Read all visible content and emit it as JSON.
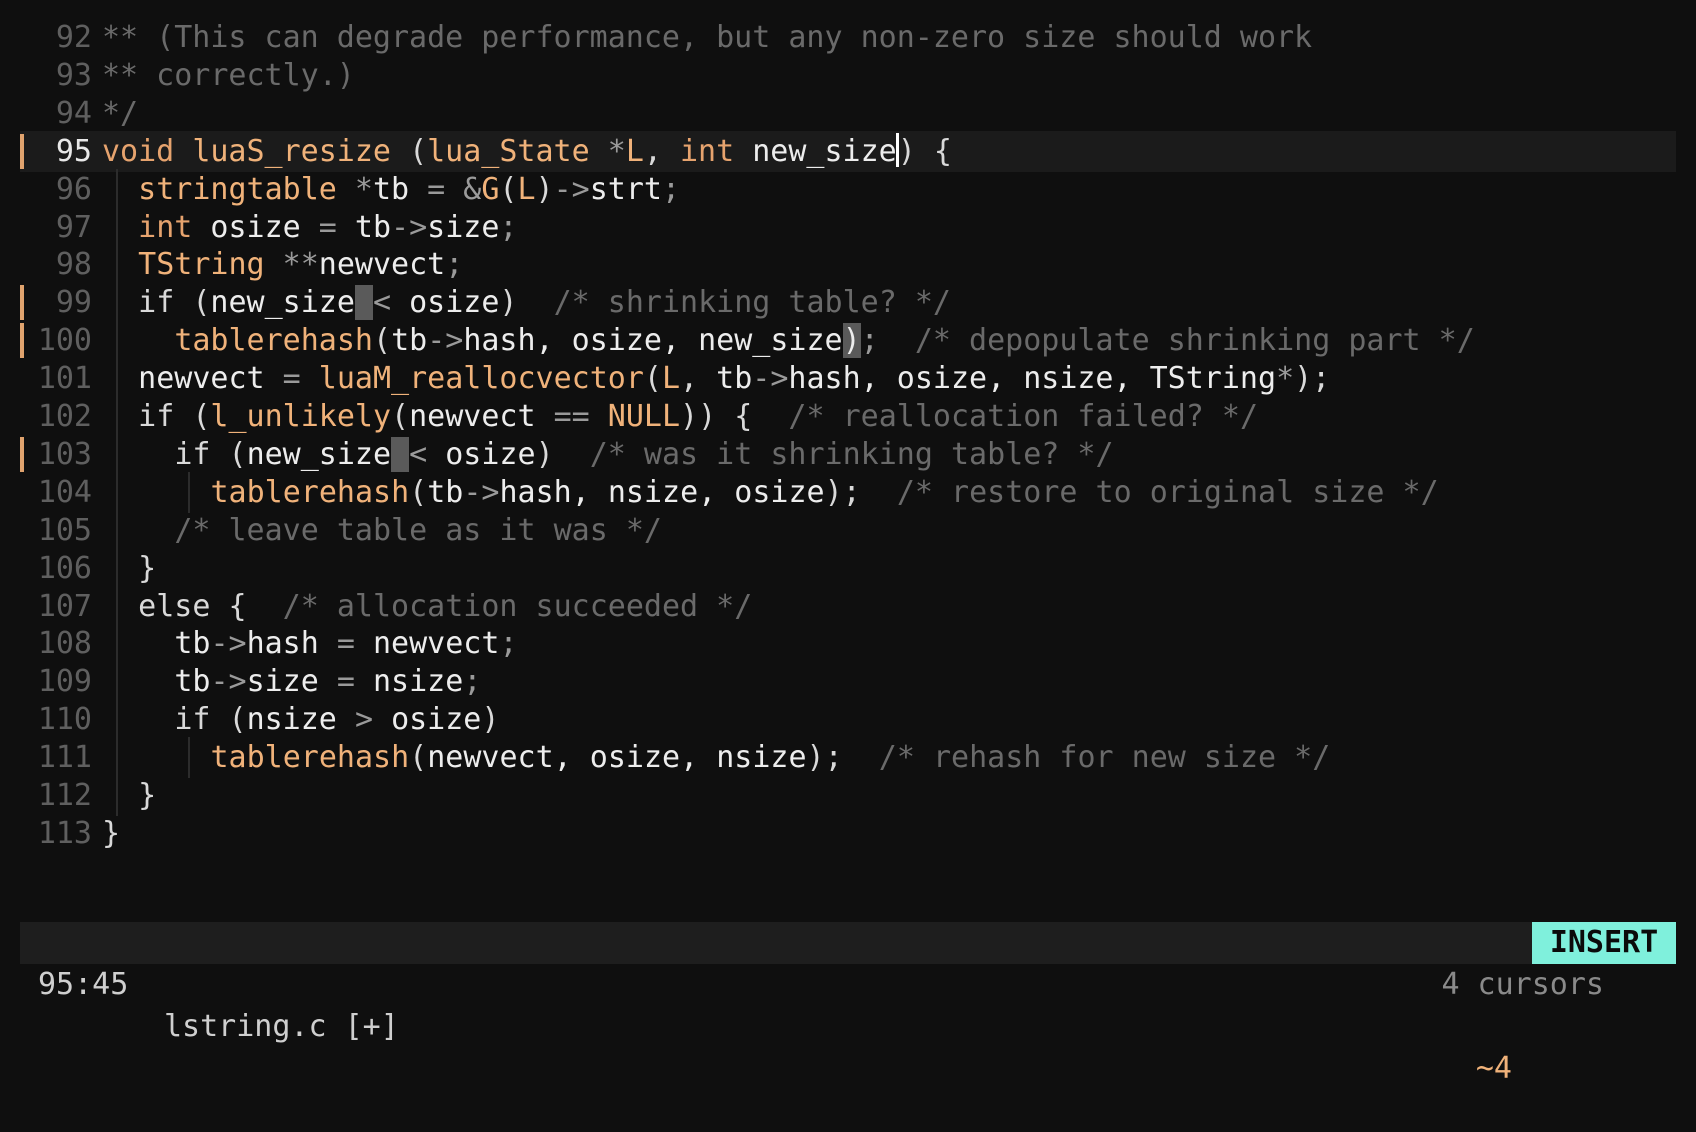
{
  "editor": {
    "lines": [
      {
        "num": "92",
        "indent": 0,
        "guides": [],
        "marker": false,
        "current": false,
        "tokens": [
          {
            "t": "** (This can degrade performance, but any non-zero size should work",
            "c": "cm"
          }
        ]
      },
      {
        "num": "93",
        "indent": 0,
        "guides": [],
        "marker": false,
        "current": false,
        "tokens": [
          {
            "t": "** correctly.)",
            "c": "cm"
          }
        ]
      },
      {
        "num": "94",
        "indent": 0,
        "guides": [],
        "marker": false,
        "current": false,
        "tokens": [
          {
            "t": "*/",
            "c": "cm"
          }
        ]
      },
      {
        "num": "95",
        "indent": 0,
        "guides": [],
        "marker": true,
        "current": true,
        "tokens": [
          {
            "t": "void ",
            "c": "kw"
          },
          {
            "t": "luaS_resize ",
            "c": "fn"
          },
          {
            "t": "(",
            "c": "pl"
          },
          {
            "t": "lua_State ",
            "c": "ty"
          },
          {
            "t": "*",
            "c": "op"
          },
          {
            "t": "L",
            "c": "ty"
          },
          {
            "t": ", ",
            "c": "pl"
          },
          {
            "t": "int ",
            "c": "kw"
          },
          {
            "t": "new_size",
            "c": "id"
          },
          {
            "t": "",
            "c": "caret"
          },
          {
            "t": ") {",
            "c": "pl"
          }
        ]
      },
      {
        "num": "96",
        "indent": 1,
        "guides": [
          0
        ],
        "marker": false,
        "current": false,
        "tokens": [
          {
            "t": "stringtable ",
            "c": "ty"
          },
          {
            "t": "*",
            "c": "op"
          },
          {
            "t": "tb ",
            "c": "id"
          },
          {
            "t": "= &",
            "c": "op"
          },
          {
            "t": "G",
            "c": "ty"
          },
          {
            "t": "(",
            "c": "pl"
          },
          {
            "t": "L",
            "c": "ty"
          },
          {
            "t": ")",
            "c": "pl"
          },
          {
            "t": "->",
            "c": "op"
          },
          {
            "t": "strt",
            "c": "id"
          },
          {
            "t": ";",
            "c": "op"
          }
        ]
      },
      {
        "num": "97",
        "indent": 1,
        "guides": [
          0
        ],
        "marker": false,
        "current": false,
        "tokens": [
          {
            "t": "int ",
            "c": "kw"
          },
          {
            "t": "osize ",
            "c": "id"
          },
          {
            "t": "= ",
            "c": "op"
          },
          {
            "t": "tb",
            "c": "id"
          },
          {
            "t": "->",
            "c": "op"
          },
          {
            "t": "size",
            "c": "id"
          },
          {
            "t": ";",
            "c": "op"
          }
        ]
      },
      {
        "num": "98",
        "indent": 1,
        "guides": [
          0
        ],
        "marker": false,
        "current": false,
        "tokens": [
          {
            "t": "TString ",
            "c": "ty"
          },
          {
            "t": "**",
            "c": "op"
          },
          {
            "t": "newvect",
            "c": "id"
          },
          {
            "t": ";",
            "c": "op"
          }
        ]
      },
      {
        "num": "99",
        "indent": 1,
        "guides": [
          0
        ],
        "marker": true,
        "current": false,
        "tokens": [
          {
            "t": "if ",
            "c": "pl"
          },
          {
            "t": "(",
            "c": "pl"
          },
          {
            "t": "new_size",
            "c": "id"
          },
          {
            "t": " ",
            "c": "block"
          },
          {
            "t": "< ",
            "c": "op"
          },
          {
            "t": "osize",
            "c": "id"
          },
          {
            "t": ")  ",
            "c": "pl"
          },
          {
            "t": "/* shrinking table? */",
            "c": "cm"
          }
        ]
      },
      {
        "num": "100",
        "indent": 2,
        "guides": [
          0
        ],
        "marker": true,
        "current": false,
        "tokens": [
          {
            "t": "tablerehash",
            "c": "fn"
          },
          {
            "t": "(",
            "c": "pl"
          },
          {
            "t": "tb",
            "c": "id"
          },
          {
            "t": "->",
            "c": "op"
          },
          {
            "t": "hash, osize, new_size",
            "c": "id"
          },
          {
            "t": ")",
            "c": "block"
          },
          {
            "t": ";  ",
            "c": "op"
          },
          {
            "t": "/* depopulate shrinking part */",
            "c": "cm"
          }
        ]
      },
      {
        "num": "101",
        "indent": 1,
        "guides": [
          0
        ],
        "marker": false,
        "current": false,
        "tokens": [
          {
            "t": "newvect ",
            "c": "id"
          },
          {
            "t": "= ",
            "c": "op"
          },
          {
            "t": "luaM_reallocvector",
            "c": "fn"
          },
          {
            "t": "(",
            "c": "pl"
          },
          {
            "t": "L",
            "c": "ty"
          },
          {
            "t": ", ",
            "c": "pl"
          },
          {
            "t": "tb",
            "c": "id"
          },
          {
            "t": "->",
            "c": "op"
          },
          {
            "t": "hash, osize, nsize, TString",
            "c": "id"
          },
          {
            "t": "*",
            "c": "op"
          },
          {
            "t": ");",
            "c": "pl"
          }
        ]
      },
      {
        "num": "102",
        "indent": 1,
        "guides": [
          0
        ],
        "marker": false,
        "current": false,
        "tokens": [
          {
            "t": "if ",
            "c": "pl"
          },
          {
            "t": "(",
            "c": "pl"
          },
          {
            "t": "l_unlikely",
            "c": "fn"
          },
          {
            "t": "(",
            "c": "pl"
          },
          {
            "t": "newvect ",
            "c": "id"
          },
          {
            "t": "== ",
            "c": "op"
          },
          {
            "t": "NULL",
            "c": "ty"
          },
          {
            "t": ")) {  ",
            "c": "pl"
          },
          {
            "t": "/* reallocation failed? */",
            "c": "cm"
          }
        ]
      },
      {
        "num": "103",
        "indent": 2,
        "guides": [
          0
        ],
        "marker": true,
        "current": false,
        "tokens": [
          {
            "t": "if ",
            "c": "pl"
          },
          {
            "t": "(",
            "c": "pl"
          },
          {
            "t": "new_size",
            "c": "id"
          },
          {
            "t": " ",
            "c": "block"
          },
          {
            "t": "< ",
            "c": "op"
          },
          {
            "t": "osize",
            "c": "id"
          },
          {
            "t": ")  ",
            "c": "pl"
          },
          {
            "t": "/* was it shrinking table? */",
            "c": "cm"
          }
        ]
      },
      {
        "num": "104",
        "indent": 3,
        "guides": [
          0,
          2
        ],
        "marker": false,
        "current": false,
        "tokens": [
          {
            "t": "tablerehash",
            "c": "fn"
          },
          {
            "t": "(",
            "c": "pl"
          },
          {
            "t": "tb",
            "c": "id"
          },
          {
            "t": "->",
            "c": "op"
          },
          {
            "t": "hash, nsize, osize",
            "c": "id"
          },
          {
            "t": ");  ",
            "c": "pl"
          },
          {
            "t": "/* restore to original size */",
            "c": "cm"
          }
        ]
      },
      {
        "num": "105",
        "indent": 2,
        "guides": [
          0
        ],
        "marker": false,
        "current": false,
        "tokens": [
          {
            "t": "/* leave table as it was */",
            "c": "cm"
          }
        ]
      },
      {
        "num": "106",
        "indent": 1,
        "guides": [
          0
        ],
        "marker": false,
        "current": false,
        "tokens": [
          {
            "t": "}",
            "c": "pl"
          }
        ]
      },
      {
        "num": "107",
        "indent": 1,
        "guides": [
          0
        ],
        "marker": false,
        "current": false,
        "tokens": [
          {
            "t": "else {  ",
            "c": "pl"
          },
          {
            "t": "/* allocation succeeded */",
            "c": "cm"
          }
        ]
      },
      {
        "num": "108",
        "indent": 2,
        "guides": [
          0
        ],
        "marker": false,
        "current": false,
        "tokens": [
          {
            "t": "tb",
            "c": "id"
          },
          {
            "t": "->",
            "c": "op"
          },
          {
            "t": "hash ",
            "c": "id"
          },
          {
            "t": "= ",
            "c": "op"
          },
          {
            "t": "newvect",
            "c": "id"
          },
          {
            "t": ";",
            "c": "op"
          }
        ]
      },
      {
        "num": "109",
        "indent": 2,
        "guides": [
          0
        ],
        "marker": false,
        "current": false,
        "tokens": [
          {
            "t": "tb",
            "c": "id"
          },
          {
            "t": "->",
            "c": "op"
          },
          {
            "t": "size ",
            "c": "id"
          },
          {
            "t": "= ",
            "c": "op"
          },
          {
            "t": "nsize",
            "c": "id"
          },
          {
            "t": ";",
            "c": "op"
          }
        ]
      },
      {
        "num": "110",
        "indent": 2,
        "guides": [
          0
        ],
        "marker": false,
        "current": false,
        "tokens": [
          {
            "t": "if ",
            "c": "pl"
          },
          {
            "t": "(",
            "c": "pl"
          },
          {
            "t": "nsize ",
            "c": "id"
          },
          {
            "t": "> ",
            "c": "op"
          },
          {
            "t": "osize",
            "c": "id"
          },
          {
            "t": ")",
            "c": "pl"
          }
        ]
      },
      {
        "num": "111",
        "indent": 3,
        "guides": [
          0,
          2
        ],
        "marker": false,
        "current": false,
        "tokens": [
          {
            "t": "tablerehash",
            "c": "fn"
          },
          {
            "t": "(",
            "c": "pl"
          },
          {
            "t": "newvect, osize, nsize",
            "c": "id"
          },
          {
            "t": ");  ",
            "c": "pl"
          },
          {
            "t": "/* rehash for new size */",
            "c": "cm"
          }
        ]
      },
      {
        "num": "112",
        "indent": 1,
        "guides": [
          0
        ],
        "marker": false,
        "current": false,
        "tokens": [
          {
            "t": "}",
            "c": "pl"
          }
        ]
      },
      {
        "num": "113",
        "indent": 0,
        "guides": [],
        "marker": false,
        "current": false,
        "tokens": [
          {
            "t": "}",
            "c": "pl"
          }
        ]
      }
    ]
  },
  "statusbar": {
    "position": "95:45",
    "filename": "lstring.c [+]",
    "cursor_indicator": "~4",
    "mode": "INSERT"
  },
  "message": "4 cursors",
  "colors": {
    "background": "#0f0f0f",
    "keyword": "#e6a36e",
    "type": "#f0b27a",
    "comment": "#6a6a6a",
    "mode_badge": "#7ff0dc",
    "change_marker": "#e0a36e"
  }
}
